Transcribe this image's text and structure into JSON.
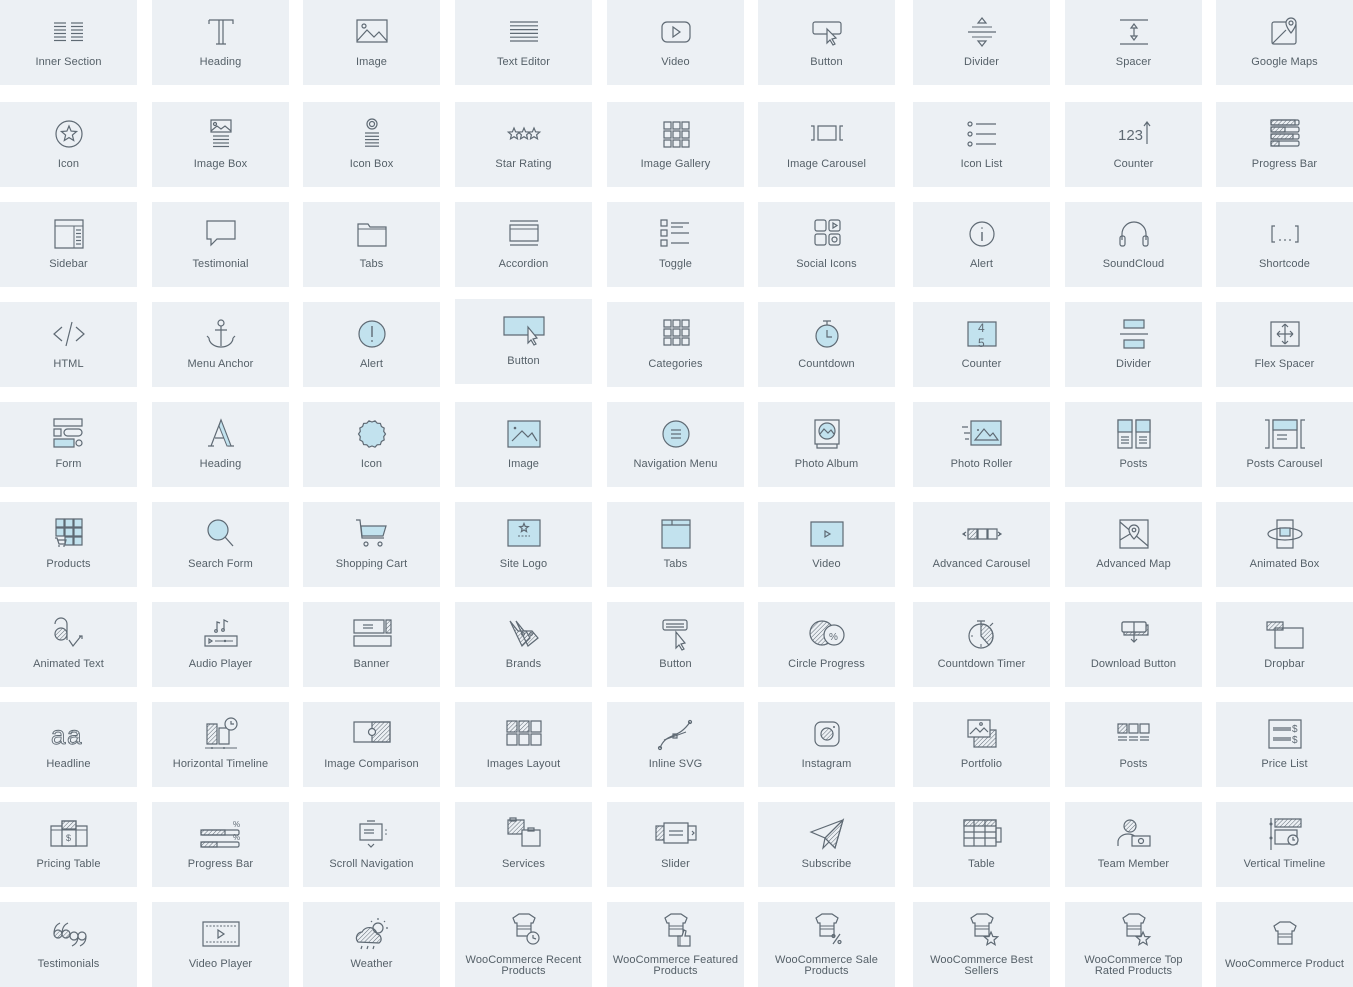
{
  "colors": {
    "tile_bg": "#ecf0f4",
    "icon_stroke": "#5f6a74",
    "icon_accent_fill": "#c2e2ee",
    "label_text": "#556068"
  },
  "widgets": [
    {
      "label": "Inner Section",
      "icon": "columns-icon"
    },
    {
      "label": "Heading",
      "icon": "heading-t-icon"
    },
    {
      "label": "Image",
      "icon": "image-icon"
    },
    {
      "label": "Text Editor",
      "icon": "text-editor-icon"
    },
    {
      "label": "Video",
      "icon": "video-play-icon"
    },
    {
      "label": "Button",
      "icon": "button-cursor-icon"
    },
    {
      "label": "Divider",
      "icon": "divider-icon"
    },
    {
      "label": "Spacer",
      "icon": "spacer-icon"
    },
    {
      "label": "Google Maps",
      "icon": "map-pin-icon"
    },
    {
      "label": "Icon",
      "icon": "star-circle-icon"
    },
    {
      "label": "Image Box",
      "icon": "image-box-icon"
    },
    {
      "label": "Icon Box",
      "icon": "icon-box-icon"
    },
    {
      "label": "Star Rating",
      "icon": "star-rating-icon"
    },
    {
      "label": "Image Gallery",
      "icon": "gallery-grid-icon"
    },
    {
      "label": "Image Carousel",
      "icon": "carousel-icon"
    },
    {
      "label": "Icon List",
      "icon": "icon-list-icon"
    },
    {
      "label": "Counter",
      "icon": "counter-123-icon"
    },
    {
      "label": "Progress Bar",
      "icon": "progress-bars-icon"
    },
    {
      "label": "Sidebar",
      "icon": "sidebar-icon"
    },
    {
      "label": "Testimonial",
      "icon": "speech-bubble-icon"
    },
    {
      "label": "Tabs",
      "icon": "folder-tabs-icon"
    },
    {
      "label": "Accordion",
      "icon": "accordion-icon"
    },
    {
      "label": "Toggle",
      "icon": "toggle-list-icon"
    },
    {
      "label": "Social Icons",
      "icon": "social-icons-icon"
    },
    {
      "label": "Alert",
      "icon": "info-circle-icon"
    },
    {
      "label": "SoundCloud",
      "icon": "headphones-icon"
    },
    {
      "label": "Shortcode",
      "icon": "shortcode-brackets-icon"
    },
    {
      "label": "HTML",
      "icon": "code-icon"
    },
    {
      "label": "Menu Anchor",
      "icon": "anchor-icon"
    },
    {
      "label": "Alert",
      "icon": "alert-exclamation-icon"
    },
    {
      "label": "Button",
      "icon": "button-pointer-icon"
    },
    {
      "label": "Categories",
      "icon": "categories-grid-icon"
    },
    {
      "label": "Countdown",
      "icon": "stopwatch-icon"
    },
    {
      "label": "Counter",
      "icon": "counter-flip-icon"
    },
    {
      "label": "Divider",
      "icon": "divider-box-icon"
    },
    {
      "label": "Flex Spacer",
      "icon": "flex-spacer-icon"
    },
    {
      "label": "Form",
      "icon": "form-icon"
    },
    {
      "label": "Heading",
      "icon": "heading-a-icon"
    },
    {
      "label": "Icon",
      "icon": "badge-icon"
    },
    {
      "label": "Image",
      "icon": "image-filled-icon"
    },
    {
      "label": "Navigation Menu",
      "icon": "nav-menu-icon"
    },
    {
      "label": "Photo Album",
      "icon": "photo-album-icon"
    },
    {
      "label": "Photo Roller",
      "icon": "photo-roller-icon"
    },
    {
      "label": "Posts",
      "icon": "posts-icon"
    },
    {
      "label": "Posts Carousel",
      "icon": "posts-carousel-icon"
    },
    {
      "label": "Products",
      "icon": "products-grid-icon"
    },
    {
      "label": "Search Form",
      "icon": "search-icon"
    },
    {
      "label": "Shopping Cart",
      "icon": "cart-icon"
    },
    {
      "label": "Site Logo",
      "icon": "site-logo-icon"
    },
    {
      "label": "Tabs",
      "icon": "tabs-window-icon"
    },
    {
      "label": "Video",
      "icon": "video-box-icon"
    },
    {
      "label": "Advanced Carousel",
      "icon": "advanced-carousel-icon"
    },
    {
      "label": "Advanced Map",
      "icon": "advanced-map-icon"
    },
    {
      "label": "Animated Box",
      "icon": "animated-box-icon"
    },
    {
      "label": "Animated Text",
      "icon": "animated-text-icon"
    },
    {
      "label": "Audio Player",
      "icon": "audio-player-icon"
    },
    {
      "label": "Banner",
      "icon": "banner-icon"
    },
    {
      "label": "Brands",
      "icon": "tags-icon"
    },
    {
      "label": "Button",
      "icon": "button-click-icon"
    },
    {
      "label": "Circle Progress",
      "icon": "circle-progress-icon"
    },
    {
      "label": "Countdown Timer",
      "icon": "countdown-timer-icon"
    },
    {
      "label": "Download Button",
      "icon": "download-button-icon"
    },
    {
      "label": "Dropbar",
      "icon": "dropbar-icon"
    },
    {
      "label": "Headline",
      "icon": "headline-aa-icon"
    },
    {
      "label": "Horizontal Timeline",
      "icon": "horizontal-timeline-icon"
    },
    {
      "label": "Image Comparison",
      "icon": "image-comparison-icon"
    },
    {
      "label": "Images Layout",
      "icon": "images-layout-icon"
    },
    {
      "label": "Inline SVG",
      "icon": "bezier-curve-icon"
    },
    {
      "label": "Instagram",
      "icon": "instagram-icon"
    },
    {
      "label": "Portfolio",
      "icon": "portfolio-icon"
    },
    {
      "label": "Posts",
      "icon": "posts-grid-icon"
    },
    {
      "label": "Price List",
      "icon": "price-list-icon"
    },
    {
      "label": "Pricing Table",
      "icon": "pricing-table-icon"
    },
    {
      "label": "Progress Bar",
      "icon": "progress-percent-icon"
    },
    {
      "label": "Scroll Navigation",
      "icon": "scroll-navigation-icon"
    },
    {
      "label": "Services",
      "icon": "services-icon"
    },
    {
      "label": "Slider",
      "icon": "slider-icon"
    },
    {
      "label": "Subscribe",
      "icon": "paper-plane-icon"
    },
    {
      "label": "Table",
      "icon": "table-icon"
    },
    {
      "label": "Team Member",
      "icon": "team-member-icon"
    },
    {
      "label": "Vertical Timeline",
      "icon": "vertical-timeline-icon"
    },
    {
      "label": "Testimonials",
      "icon": "quotes-icon"
    },
    {
      "label": "Video Player",
      "icon": "video-player-icon"
    },
    {
      "label": "Weather",
      "icon": "weather-icon"
    },
    {
      "label": "WooCommerce Recent Products",
      "icon": "woo-recent-icon"
    },
    {
      "label": "WooCommerce Featured Products",
      "icon": "woo-featured-icon"
    },
    {
      "label": "WooCommerce Sale Products",
      "icon": "woo-sale-icon"
    },
    {
      "label": "WooCommerce Best Sellers",
      "icon": "woo-best-sellers-icon"
    },
    {
      "label": "WooCommerce Top Rated Products",
      "icon": "woo-top-rated-icon"
    },
    {
      "label": "WooCommerce Product",
      "icon": "woo-product-icon"
    }
  ]
}
